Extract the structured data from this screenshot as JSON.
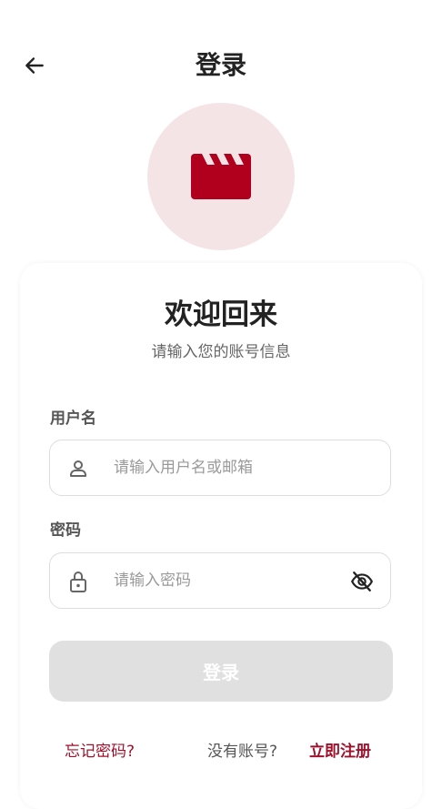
{
  "header": {
    "title": "登录",
    "back_icon": "arrow-left-icon"
  },
  "logo": {
    "icon": "clapperboard-icon",
    "icon_color": "#b0001e",
    "bg_color": "#f5e4e6"
  },
  "card": {
    "welcome": "欢迎回来",
    "subtitle": "请输入您的账号信息"
  },
  "username": {
    "label": "用户名",
    "placeholder": "请输入用户名或邮箱",
    "value": "",
    "icon": "user-icon"
  },
  "password": {
    "label": "密码",
    "placeholder": "请输入密码",
    "value": "",
    "icon": "lock-icon",
    "toggle_icon": "eye-off-icon"
  },
  "login_button": {
    "label": "登录",
    "state": "disabled"
  },
  "footer": {
    "forgot_password": "忘记密码?",
    "no_account": "没有账号?",
    "register": "立即注册"
  },
  "colors": {
    "accent": "#a0102a",
    "button_disabled": "#e0e0e0"
  }
}
